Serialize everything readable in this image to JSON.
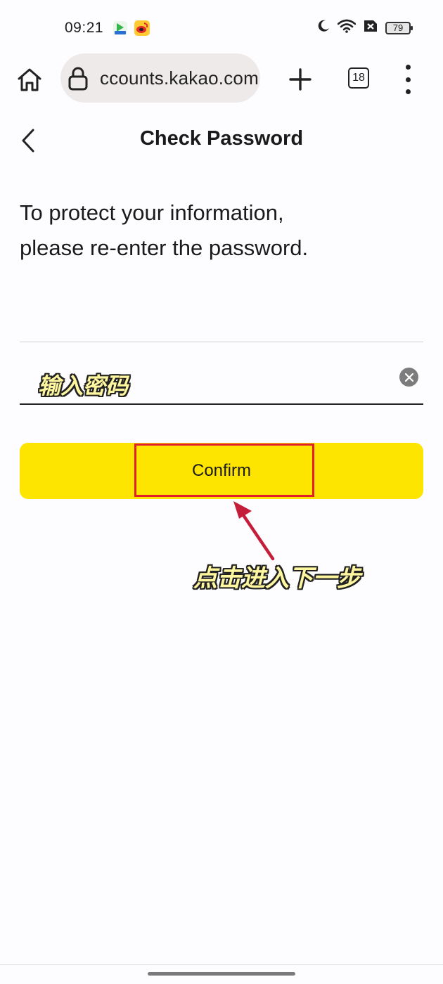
{
  "status_bar": {
    "time": "09:21",
    "battery": "79",
    "icons": [
      "video-app-icon",
      "weibo-app-icon",
      "moon-icon",
      "wifi-icon",
      "sim-off-icon",
      "battery-icon"
    ]
  },
  "browser": {
    "url": "ccounts.kakao.com",
    "tab_count": "18",
    "icons": [
      "home-icon",
      "lock-icon",
      "plus-icon",
      "tabs-icon",
      "more-vertical-icon"
    ]
  },
  "page": {
    "title": "Check Password",
    "description_line1": "To protect your information,",
    "description_line2": "please re-enter the password.",
    "password_hint": "输入密码",
    "confirm_label": "Confirm",
    "instruction": "点击进入下一步"
  },
  "colors": {
    "button": "#fee500",
    "highlight": "#e0202c",
    "arrow": "#c41e3a",
    "overlay_text": "#fff7a0"
  }
}
